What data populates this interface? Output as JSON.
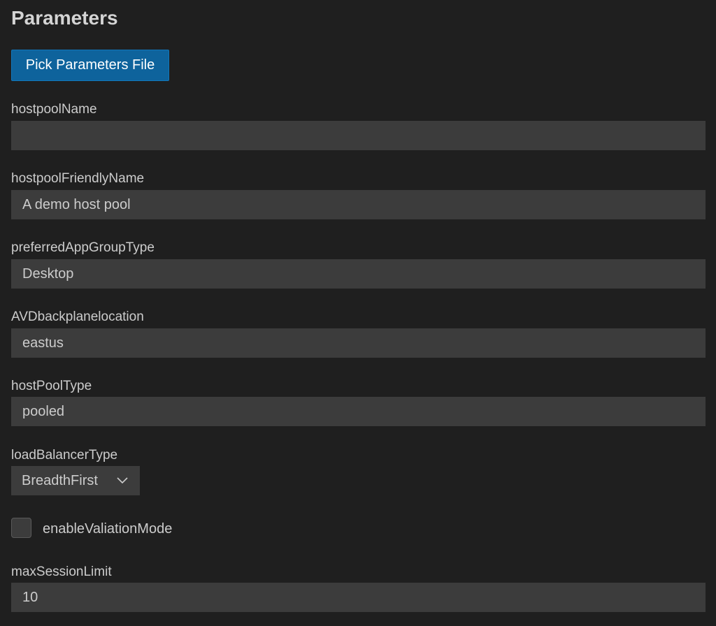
{
  "page": {
    "title": "Parameters"
  },
  "actions": {
    "pick_file_label": "Pick Parameters File"
  },
  "fields": {
    "hostpoolName": {
      "label": "hostpoolName",
      "value": ""
    },
    "hostpoolFriendlyName": {
      "label": "hostpoolFriendlyName",
      "value": "A demo host pool"
    },
    "preferredAppGroupType": {
      "label": "preferredAppGroupType",
      "value": "Desktop"
    },
    "AVDbackplanelocation": {
      "label": "AVDbackplanelocation",
      "value": "eastus"
    },
    "hostPoolType": {
      "label": "hostPoolType",
      "value": "pooled"
    },
    "loadBalancerType": {
      "label": "loadBalancerType",
      "value": "BreadthFirst"
    },
    "enableValiationMode": {
      "label": "enableValiationMode",
      "checked": false
    },
    "maxSessionLimit": {
      "label": "maxSessionLimit",
      "value": "10"
    }
  },
  "colors": {
    "background": "#1f1f1f",
    "input_background": "#3c3c3c",
    "button_primary": "#0e639c",
    "text": "#cccccc"
  },
  "icons": {
    "dropdown": "chevron-down-icon"
  }
}
